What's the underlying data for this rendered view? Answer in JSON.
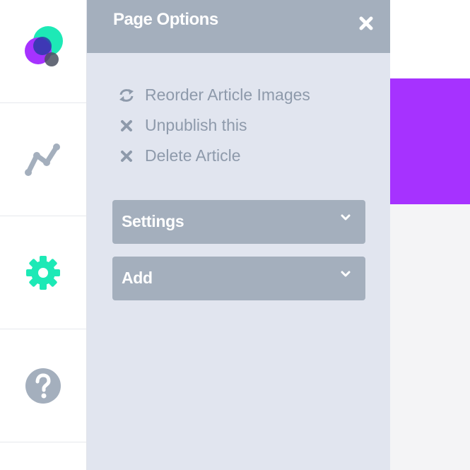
{
  "rail": {
    "items": [
      {
        "icon": "app-logo"
      },
      {
        "icon": "analytics-icon"
      },
      {
        "icon": "gear-icon"
      },
      {
        "icon": "help-icon"
      }
    ]
  },
  "panel": {
    "title": "Page Options",
    "close_icon": "close-icon",
    "actions": [
      {
        "label": "Reorder Article Images",
        "icon": "refresh-icon"
      },
      {
        "label": "Unpublish this",
        "icon": "x-icon"
      },
      {
        "label": "Delete Article",
        "icon": "x-icon"
      }
    ],
    "sections": [
      {
        "label": "Settings",
        "icon": "chevron-down-icon"
      },
      {
        "label": "Add",
        "icon": "chevron-down-icon"
      }
    ]
  },
  "colors": {
    "panel_header": "#a4afbd",
    "panel_bg": "#e1e5ef",
    "banner": "#a632ff",
    "accent": "#1de9b6",
    "action_text": "#8e9aab"
  }
}
